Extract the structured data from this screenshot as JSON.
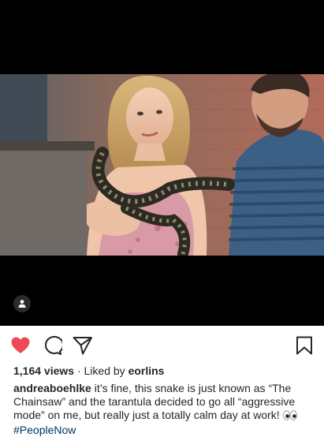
{
  "post": {
    "views_count": "1,164 views",
    "separator": " · ",
    "liked_by_prefix": "Liked by ",
    "liked_by_user": "eorlins",
    "caption": {
      "username": "andreaboehlke",
      "text": " it’s fine, this snake is just known as “The Chainsaw” and the tarantula decided to go all “aggressive mode” on me, but really just a totally calm day at work! ",
      "hashtag": "#PeopleNow"
    }
  },
  "icons": {
    "like": "heart-icon",
    "comment": "comment-bubble-icon",
    "share": "paper-plane-icon",
    "save": "bookmark-icon",
    "tag": "person-tag-icon",
    "emoji": "eyes-emoji"
  },
  "colors": {
    "like_active": "#ed4956",
    "text": "#262626",
    "hashtag": "#003569",
    "media_bg": "#000000"
  },
  "state": {
    "liked": true
  }
}
